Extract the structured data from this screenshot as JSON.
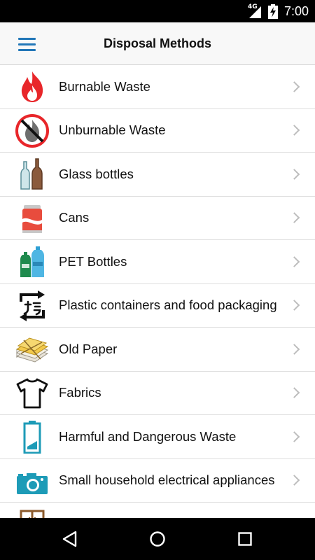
{
  "status_bar": {
    "network": "4G",
    "time": "7:00"
  },
  "app_bar": {
    "title": "Disposal Methods",
    "menu_icon": "hamburger-menu-icon"
  },
  "methods": [
    {
      "label": "Burnable Waste",
      "icon": "fire-icon"
    },
    {
      "label": "Unburnable Waste",
      "icon": "no-fire-icon"
    },
    {
      "label": "Glass bottles",
      "icon": "glass-bottles-icon"
    },
    {
      "label": "Cans",
      "icon": "can-icon"
    },
    {
      "label": "PET Bottles",
      "icon": "pet-bottles-icon"
    },
    {
      "label": "Plastic containers and food packaging",
      "icon": "plastic-recycle-mark-icon"
    },
    {
      "label": "Old Paper",
      "icon": "paper-stack-icon"
    },
    {
      "label": "Fabrics",
      "icon": "tshirt-icon"
    },
    {
      "label": "Harmful and Dangerous Waste",
      "icon": "battery-icon"
    },
    {
      "label": "Small household electrical appliances",
      "icon": "camera-icon"
    },
    {
      "label": "",
      "icon": "furniture-icon"
    }
  ],
  "nav_bar": {
    "back_icon": "back-triangle-icon",
    "home_icon": "home-circle-icon",
    "recents_icon": "recents-square-icon"
  },
  "colors": {
    "accent": "#2277b8",
    "fire": "#e8262a",
    "status_bar": "#000000",
    "divider": "#dedede"
  }
}
